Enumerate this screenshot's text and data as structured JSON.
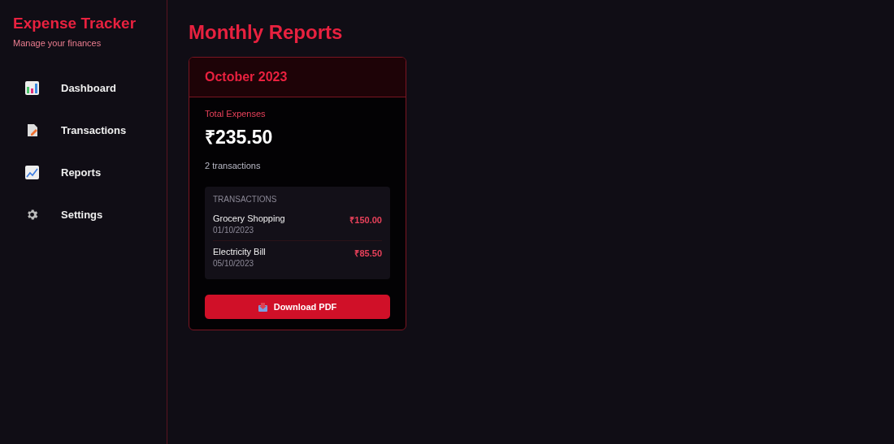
{
  "sidebar": {
    "title": "Expense Tracker",
    "subtitle": "Manage your finances",
    "items": [
      {
        "label": "Dashboard"
      },
      {
        "label": "Transactions"
      },
      {
        "label": "Reports"
      },
      {
        "label": "Settings"
      }
    ]
  },
  "page_title": "Monthly Reports",
  "reports": [
    {
      "month": "October 2023",
      "total_label": "Total Expenses",
      "total": "₹235.50",
      "count": "2 transactions",
      "transactions_heading": "TRANSACTIONS",
      "transactions": [
        {
          "name": "Grocery Shopping",
          "date": "01/10/2023",
          "amount": "₹150.00"
        },
        {
          "name": "Electricity Bill",
          "date": "05/10/2023",
          "amount": "₹85.50"
        }
      ],
      "button": "Download PDF"
    }
  ]
}
